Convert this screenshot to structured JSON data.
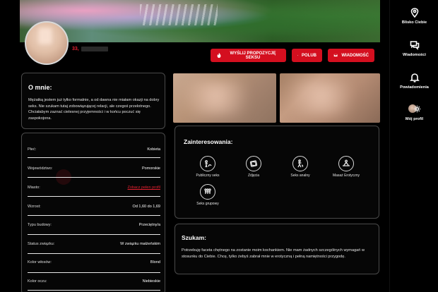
{
  "profile": {
    "age": "33,",
    "actions": {
      "offer": "Wyślij propozycję seksu",
      "like": "Polub",
      "message": "Wiadomość"
    }
  },
  "about": {
    "title": "O mnie:",
    "text": "Mężatką jestem już tylko formalnie, a od dawna nie miałam okazji na dobry seks. Nie szukam tutaj zobowiązującej relacji, ale czegoś przelotnego. Chciałabym zaznać cielesnej przyjemności i w końcu poczuć się zaspokojona."
  },
  "details": [
    {
      "label": "Płeć:",
      "value": "Kobieta"
    },
    {
      "label": "Województwo:",
      "value": "Pomorskie"
    },
    {
      "label": "Miasto:",
      "value": "Zobacz pełen profil"
    },
    {
      "label": "Wzrost:",
      "value": "Od 1,60 do 1,69"
    },
    {
      "label": "Typu budowy:",
      "value": "Przeciętny/a"
    },
    {
      "label": "Status związku:",
      "value": "W związku małżeńskim"
    },
    {
      "label": "Kolor włosów:",
      "value": "Blond"
    },
    {
      "label": "Kolor oczu:",
      "value": "Niebieskie"
    }
  ],
  "interests": {
    "title": "Zainteresowania:",
    "items": [
      {
        "label": "Publiczny seks",
        "icon": "public-sex-icon"
      },
      {
        "label": "Zdjęcia",
        "icon": "photos-icon"
      },
      {
        "label": "Seks analny",
        "icon": "anal-icon"
      },
      {
        "label": "Masaż Erotyczny",
        "icon": "massage-icon"
      },
      {
        "label": "Seks grupowy",
        "icon": "group-icon"
      }
    ]
  },
  "search": {
    "title": "Szukam:",
    "text": "Potrzebuję faceta chętnego na zostanie moim kochankiem. Nie mam żadnych szczególnych wymagań w stosunku do Ciebie. Chcę, tylko żebyś zabrał mnie w erotyczną i pełną namiętności przygodę."
  },
  "rail": [
    {
      "label": "Blisko Ciebie",
      "icon": "location-pin-icon"
    },
    {
      "label": "Wiadomości",
      "icon": "chat-icon"
    },
    {
      "label": "Powiadomienia",
      "icon": "bell-icon"
    },
    {
      "label": "Mój profil",
      "icon": "profile-gear-icon"
    }
  ],
  "colors": {
    "accent": "#d40f1f",
    "background": "#000000",
    "card_border": "#4a4a4a"
  }
}
